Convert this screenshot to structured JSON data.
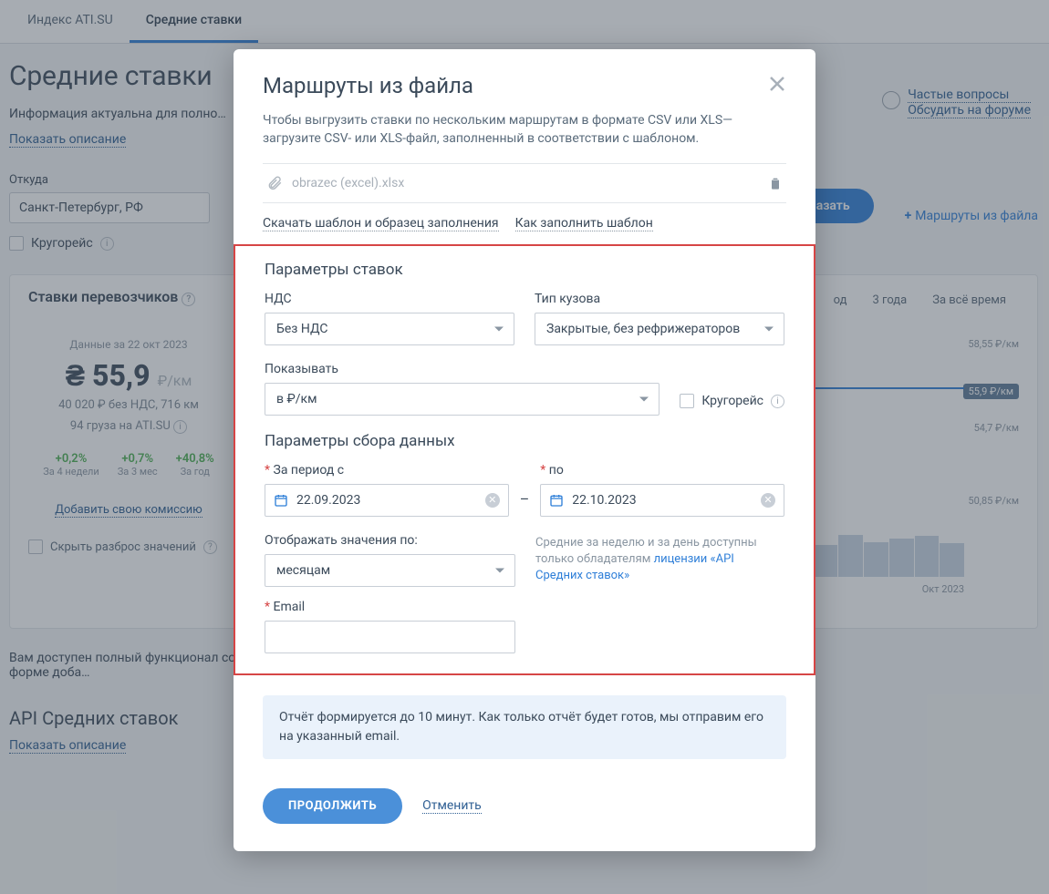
{
  "tabs": {
    "index": "Индекс ATI.SU",
    "avg": "Средние ставки"
  },
  "page": {
    "title": "Средние ставки",
    "subtitle": "Информация актуальна для полно…",
    "show_description": "Показать описание"
  },
  "faq": {
    "questions": "Частые вопросы",
    "forum": "Обсудить на форуме"
  },
  "form": {
    "from_label": "Откуда",
    "from_value": "Санкт-Петербург, РФ",
    "show_btn": "азать",
    "routes_link": "Маршруты из файла",
    "round_trip": "Кругорейс"
  },
  "panel": {
    "title": "Ставки перевозчиков",
    "tab_year": "од",
    "tab_3y": "3 года",
    "tab_all": "За всё время",
    "data_date": "Данные за 22 окт 2023",
    "price": "55,9",
    "unit": "₽/км",
    "sub": "40 020 ₽ без НДС, 716 км",
    "cargo": "94 груза на ATI.SU",
    "s1v": "+0,2%",
    "s1l": "За 4 недели",
    "s2v": "+0,7%",
    "s2l": "За 3 мес",
    "s3v": "+40,8%",
    "s3l": "За год",
    "add_comm": "Добавить свою комиссию",
    "hide_scatter": "Скрыть разброс значений",
    "y1": "58,55 ₽/км",
    "badge": "55,9 ₽/км",
    "y2": "54,7 ₽/км",
    "y3": "50,85 ₽/км",
    "x": "Окт 2023"
  },
  "access_text": "Вам доступен полный функционал со средними ценами в форме доба…",
  "api": {
    "title": "API Средних ставок",
    "desc": "Показать описание"
  },
  "modal": {
    "title": "Маршруты из файла",
    "desc": "Чтобы выгрузить ставки по нескольким маршрутам в формате CSV или XLS— загрузите CSV- или XLS-файл, заполненный в соответствии с шаблоном.",
    "file": "obrazec (excel).xlsx",
    "dl_template": "Скачать шаблон и образец заполнения",
    "how_fill": "Как заполнить шаблон",
    "section_rates": "Параметры ставок",
    "nds_label": "НДС",
    "nds_value": "Без НДС",
    "body_label": "Тип кузова",
    "body_value": "Закрытые, без рефрижераторов",
    "show_label": "Показывать",
    "show_value": "в ₽/км",
    "round_trip": "Кругорейс",
    "section_data": "Параметры сбора данных",
    "period_from": "За период с",
    "period_to": "по",
    "date_from": "22.09.2023",
    "date_to": "22.10.2023",
    "display_by_label": "Отображать значения по:",
    "display_by_value": "месяцам",
    "license_hint_pre": "Средние за неделю и за день доступны только обладателям ",
    "license_link": "лицензии «API Средних ставок»",
    "email_label": "Email",
    "email_value": "",
    "note": "Отчёт формируется до 10 минут. Как только отчёт будет готов, мы отправим его на указанный email.",
    "continue": "ПРОДОЛЖИТЬ",
    "cancel": "Отменить"
  }
}
